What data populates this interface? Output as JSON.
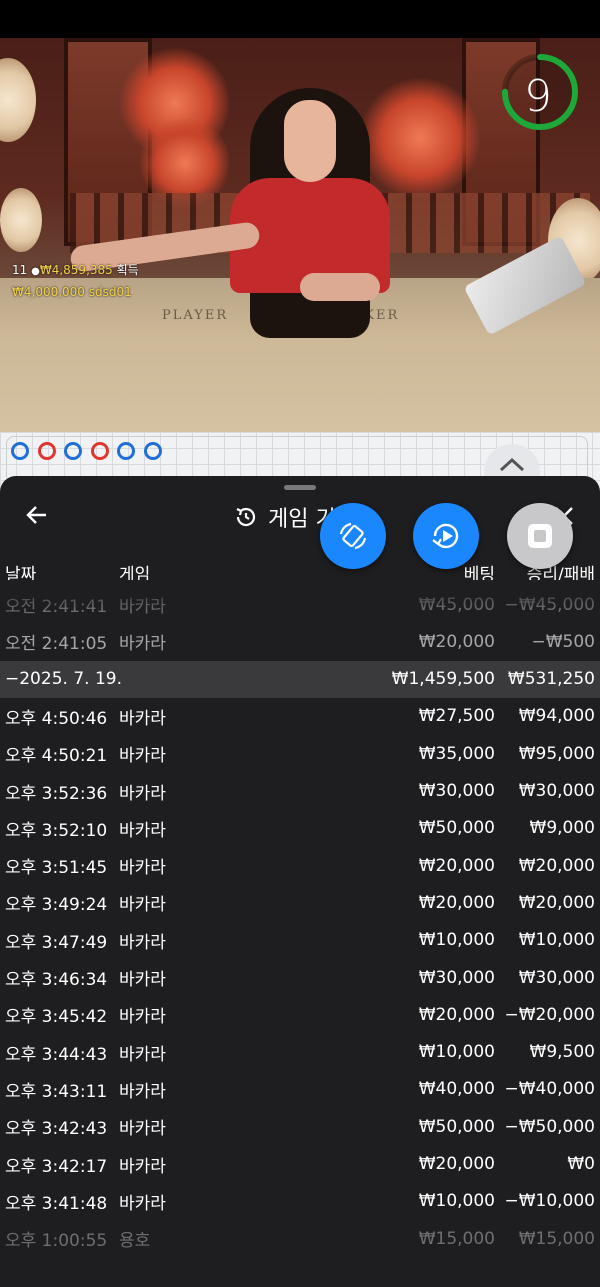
{
  "video": {
    "timer": "9",
    "table_player_label": "PLAYER",
    "table_banker_label": "BANKER",
    "winner_line": {
      "count": "11",
      "amount": "₩4,859,385",
      "suffix": "획득"
    },
    "bet_line": {
      "amount": "₩4,000,000",
      "user": "sdsd01"
    },
    "timer_progress": 0.75,
    "accent_green": "#1fa83a"
  },
  "road": {
    "beads": [
      "blue",
      "red",
      "blue",
      "red",
      "blue",
      "blue"
    ],
    "colors": {
      "blue": "#1e6fd9",
      "red": "#e0362f"
    }
  },
  "panel": {
    "title": "게임 기",
    "columns": {
      "date": "날짜",
      "game": "게임",
      "bet": "베팅",
      "winloss": "승리/패배"
    },
    "rows": [
      {
        "time": "오전 2:41:41",
        "game": "바카라",
        "bet": "₩45,000",
        "win": "−₩45,000"
      },
      {
        "time": "오전 2:41:05",
        "game": "바카라",
        "bet": "₩20,000",
        "win": "−₩500"
      },
      {
        "group_date": "−2025. 7. 19.",
        "bet": "₩1,459,500",
        "win": "₩531,250"
      },
      {
        "time": "오후 4:50:46",
        "game": "바카라",
        "bet": "₩27,500",
        "win": "₩94,000"
      },
      {
        "time": "오후 4:50:21",
        "game": "바카라",
        "bet": "₩35,000",
        "win": "₩95,000"
      },
      {
        "time": "오후 3:52:36",
        "game": "바카라",
        "bet": "₩30,000",
        "win": "₩30,000"
      },
      {
        "time": "오후 3:52:10",
        "game": "바카라",
        "bet": "₩50,000",
        "win": "₩9,000"
      },
      {
        "time": "오후 3:51:45",
        "game": "바카라",
        "bet": "₩20,000",
        "win": "₩20,000"
      },
      {
        "time": "오후 3:49:24",
        "game": "바카라",
        "bet": "₩20,000",
        "win": "₩20,000"
      },
      {
        "time": "오후 3:47:49",
        "game": "바카라",
        "bet": "₩10,000",
        "win": "₩10,000"
      },
      {
        "time": "오후 3:46:34",
        "game": "바카라",
        "bet": "₩30,000",
        "win": "₩30,000"
      },
      {
        "time": "오후 3:45:42",
        "game": "바카라",
        "bet": "₩20,000",
        "win": "−₩20,000"
      },
      {
        "time": "오후 3:44:43",
        "game": "바카라",
        "bet": "₩10,000",
        "win": "₩9,500"
      },
      {
        "time": "오후 3:43:11",
        "game": "바카라",
        "bet": "₩40,000",
        "win": "−₩40,000"
      },
      {
        "time": "오후 3:42:43",
        "game": "바카라",
        "bet": "₩50,000",
        "win": "−₩50,000"
      },
      {
        "time": "오후 3:42:17",
        "game": "바카라",
        "bet": "₩20,000",
        "win": "₩0"
      },
      {
        "time": "오후 3:41:48",
        "game": "바카라",
        "bet": "₩10,000",
        "win": "−₩10,000"
      },
      {
        "time": "오후 1:00:55",
        "game": "용호",
        "bet": "₩15,000",
        "win": "₩15,000"
      }
    ]
  },
  "icons": {
    "back": "arrow-left-icon",
    "history": "history-clock-icon",
    "close": "close-icon",
    "rotate": "rotate-screen-icon",
    "replay": "replay-icon",
    "stop": "stop-icon",
    "collapse": "chevron-up-icon"
  },
  "colors": {
    "fab_blue": "#1a87ff",
    "panel_bg": "#1e1e20",
    "group_row_bg": "#3a3a3c"
  }
}
